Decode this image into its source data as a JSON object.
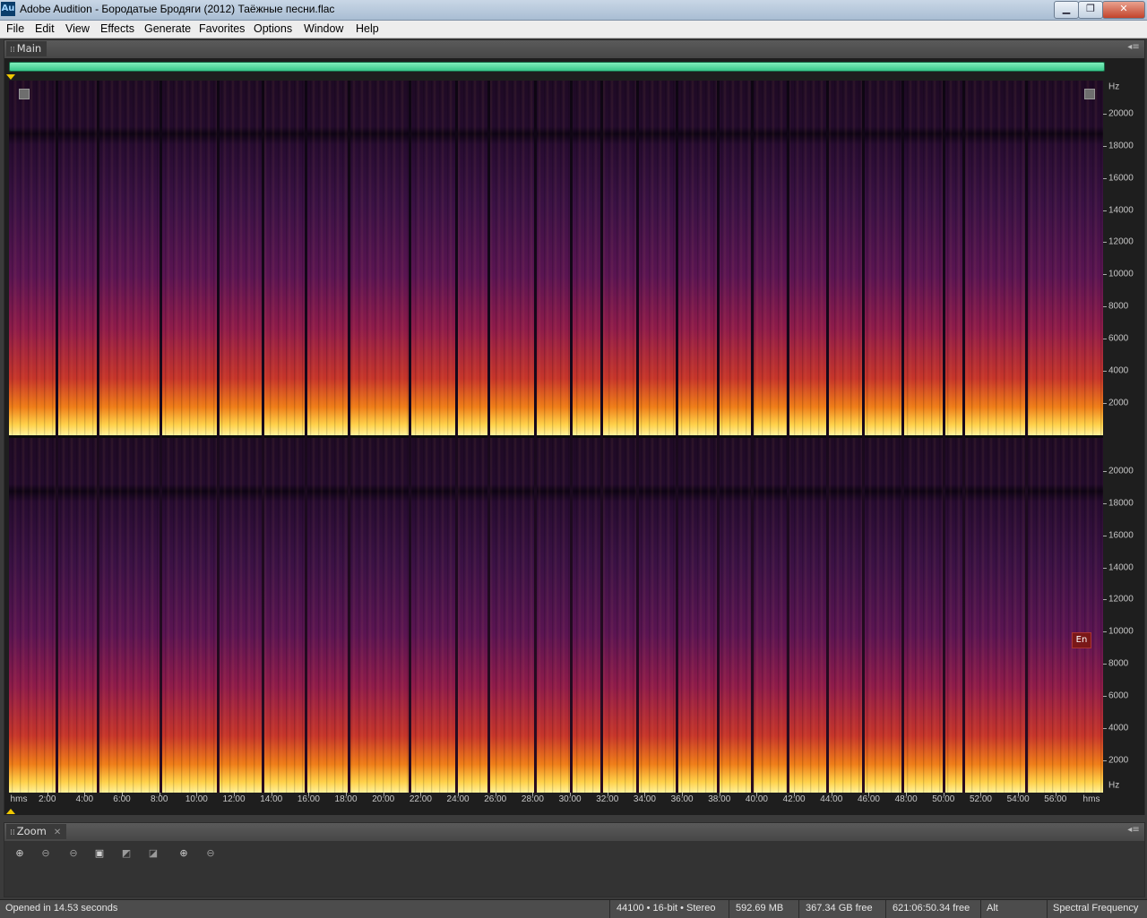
{
  "window": {
    "app_icon": "Au",
    "title": "Adobe Audition - Бородатые Бродяги (2012) Таёжные песни.flac",
    "min_label": "▁",
    "max_label": "❐",
    "close_label": "✕"
  },
  "menu": [
    "File",
    "Edit",
    "View",
    "Effects",
    "Generate",
    "Favorites",
    "Options",
    "Window",
    "Help"
  ],
  "main_panel": {
    "tab": "Main",
    "freq_unit": "Hz",
    "freq_labels": [
      "20000",
      "18000",
      "16000",
      "14000",
      "12000",
      "10000",
      "8000",
      "6000",
      "4000",
      "2000"
    ],
    "time_unit": "hms",
    "time_labels": [
      "2:00",
      "4:00",
      "6:00",
      "8:00",
      "10:00",
      "12:00",
      "14:00",
      "16:00",
      "18:00",
      "20:00",
      "22:00",
      "24:00",
      "26:00",
      "28:00",
      "30:00",
      "32:00",
      "34:00",
      "36:00",
      "38:00",
      "40:00",
      "42:00",
      "44:00",
      "46:00",
      "48:00",
      "50:00",
      "52:00",
      "54:00",
      "56:00"
    ],
    "en_badge": "En"
  },
  "zoom_panel": {
    "tab": "Zoom",
    "close_glyph": "✕",
    "buttons": [
      {
        "name": "zoom-in-amplitude",
        "glyph": "⊕"
      },
      {
        "name": "zoom-out-amplitude",
        "glyph": "⊖"
      },
      {
        "name": "zoom-out-full",
        "glyph": "⊖"
      },
      {
        "name": "zoom-to-selection",
        "glyph": "▣"
      },
      {
        "name": "zoom-left-edge",
        "glyph": "◩"
      },
      {
        "name": "zoom-right-edge",
        "glyph": "◪"
      },
      {
        "name": "zoom-in-vertical",
        "glyph": "⊕"
      },
      {
        "name": "zoom-out-vertical",
        "glyph": "⊖"
      }
    ]
  },
  "status": {
    "message": "Opened in 14.53 seconds",
    "format": "44100 • 16-bit • Stereo",
    "file_size": "592.69 MB",
    "disk_free": "367.34 GB free",
    "time_free": "621:06:50.34 free",
    "key_state": "Alt",
    "view_mode": "Spectral Frequency"
  },
  "colors": {
    "scrollbar": "#4fdc9e",
    "playhead": "#f0c800",
    "spectrum_hot": "#ffd24a",
    "spectrum_cold": "#230b2c"
  }
}
